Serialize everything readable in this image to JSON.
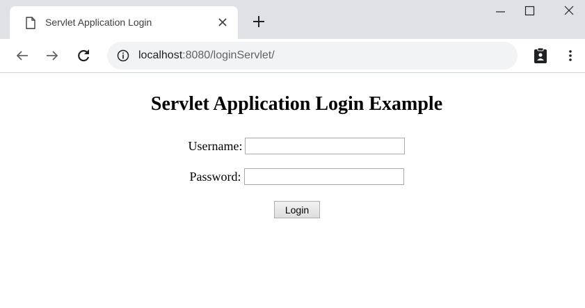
{
  "tab": {
    "title": "Servlet Application Login",
    "icon": "page-icon"
  },
  "toolbar": {
    "url_host": "localhost",
    "url_rest": ":8080/loginServlet/"
  },
  "page": {
    "title": "Servlet Application Login Example",
    "username_label": "Username:",
    "username_value": "",
    "password_label": "Password:",
    "password_value": "",
    "login_label": "Login"
  },
  "colors": {
    "tabstrip_bg": "#dee1e6",
    "omnibox_bg": "#f1f3f4",
    "icon": "#5f6368"
  }
}
